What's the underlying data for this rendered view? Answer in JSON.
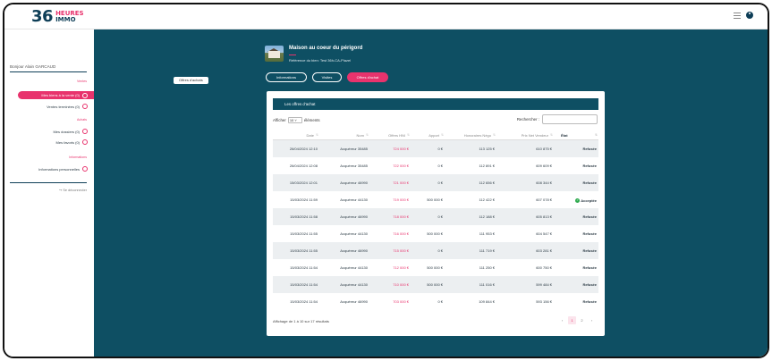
{
  "brand": {
    "number": "36",
    "word1": "HEURES",
    "word2": "IMMO"
  },
  "sidebar": {
    "greeting": "Bonjour Alain GARCAUD",
    "sections": {
      "ventes": "Ventes",
      "achats": "Achats",
      "informations": "Informations"
    },
    "items": [
      {
        "label": "Mes biens à la vente (0)",
        "icon": "home-icon",
        "active": true
      },
      {
        "label": "Ventes terminées (0)",
        "icon": "check-circle-icon",
        "active": false
      },
      {
        "label": "Mes dossiers (0)",
        "icon": "home-icon",
        "active": false
      },
      {
        "label": "Mes favoris (0)",
        "icon": "heart-icon",
        "active": false
      },
      {
        "label": "Informations personnelles",
        "icon": "user-icon",
        "active": false
      }
    ],
    "logout": "Se déconnecter"
  },
  "main": {
    "breadcrumb": "Offres d'achats",
    "property": {
      "title": "Maison au coeur du périgord",
      "reference": "Référence du bien: Test 36h-CA-Plazel"
    },
    "tabs": [
      {
        "label": "Informations",
        "active": false
      },
      {
        "label": "Visites",
        "active": false
      },
      {
        "label": "Offres d'achat",
        "active": true
      }
    ],
    "panel": {
      "title": "Les offres d'achat",
      "show_prefix": "Afficher",
      "show_value": "10",
      "show_suffix": "éléments",
      "search_label": "Rechercher :",
      "search_value": "",
      "columns": [
        "Date",
        "Nom",
        "Offres HNI",
        "Apport",
        "Honoraires Négo",
        "Prix Net Vendeur",
        "État"
      ],
      "rows": [
        [
          "26/04/2024 12:10",
          "Acquéreur 35485",
          "724 000 €",
          "0 €",
          "113 125 €",
          "610 875 €",
          "Refusée"
        ],
        [
          "26/04/2024 12:08",
          "Acquéreur 35485",
          "722 000 €",
          "0 €",
          "112 891 €",
          "609 609 €",
          "Refusée"
        ],
        [
          "15/03/2024 12:01",
          "Acquéreur 46990",
          "721 000 €",
          "0 €",
          "112 656 €",
          "608 344 €",
          "Refusée"
        ],
        [
          "15/03/2024 11:59",
          "Acquéreur 44130",
          "719 000 €",
          "500 000 €",
          "112 422 €",
          "607 078 €",
          "Acceptée"
        ],
        [
          "15/03/2024 11:58",
          "Acquéreur 46990",
          "718 000 €",
          "0 €",
          "112 188 €",
          "605 813 €",
          "Refusée"
        ],
        [
          "15/03/2024 11:55",
          "Acquéreur 44130",
          "716 000 €",
          "500 000 €",
          "111 953 €",
          "604 547 €",
          "Refusée"
        ],
        [
          "15/03/2024 11:55",
          "Acquéreur 46990",
          "715 000 €",
          "0 €",
          "111 719 €",
          "603 281 €",
          "Refusée"
        ],
        [
          "15/03/2024 11:54",
          "Acquéreur 44130",
          "712 000 €",
          "500 000 €",
          "111 250 €",
          "600 750 €",
          "Refusée"
        ],
        [
          "15/03/2024 11:54",
          "Acquéreur 44130",
          "710 000 €",
          "500 000 €",
          "111 016 €",
          "599 484 €",
          "Refusée"
        ],
        [
          "15/03/2024 11:54",
          "Acquéreur 46990",
          "703 000 €",
          "0 €",
          "109 844 €",
          "593 156 €",
          "Refusée"
        ]
      ],
      "footer": "Affichage de 1 à 10 sur 17 résultats",
      "pagination": {
        "prev": "‹",
        "pages": [
          "1",
          "2"
        ],
        "current": "1",
        "next": "›"
      }
    }
  },
  "colors": {
    "accent": "#e8336d",
    "brand": "#0e4f63",
    "navy": "#0e3e57",
    "accepted": "#2eaa4e"
  }
}
